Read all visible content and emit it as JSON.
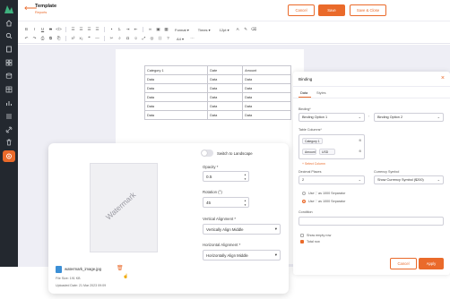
{
  "colors": {
    "accent": "#ea6a2a",
    "sidebar": "#23282f",
    "canvas": "#eeeef5"
  },
  "sidebar": {
    "icons": [
      "home-icon",
      "search-icon",
      "document-icon",
      "grid-icon",
      "database-icon",
      "table-icon",
      "chart-icon",
      "list-icon",
      "link-icon",
      "trash-icon",
      "settings-icon"
    ]
  },
  "header": {
    "title": "Template",
    "subtitle": "Reports",
    "cancel_label": "Cancel",
    "save_label": "Save",
    "save_close_label": "Save & Close"
  },
  "toolbar": {
    "format_label": "Format",
    "font_label": "Times",
    "size_label": "12pt",
    "zoom_label": "A4"
  },
  "doc_table": {
    "headers": [
      "Category 1",
      "Date",
      "Amount"
    ],
    "rows": [
      [
        "Data",
        "Data",
        "Data"
      ],
      [
        "Data",
        "Data",
        "Data"
      ],
      [
        "Data",
        "Data",
        "Data"
      ],
      [
        "Data",
        "Data",
        "Data"
      ],
      [
        "Data",
        "Data",
        "Data"
      ]
    ]
  },
  "binding": {
    "title": "Binding",
    "tabs": [
      "Data",
      "Styles"
    ],
    "binding_label": "Binding*",
    "option1": "Binding Option 1",
    "option2": "Binding Option 2",
    "table_columns_label": "Table Columns*",
    "chip1": "Category 1",
    "chip2_name": "Amount",
    "chip2_value": "USD",
    "select_column": "+ Select Column",
    "decimal_label": "Decimal Places",
    "decimal_value": "2",
    "currency_label": "Currency Symbol",
    "currency_value": "Show Currency Symbol ($200)",
    "sep1": "Use ',' as 1000 Separator",
    "sep2": "Use '.' as 1000 Separator",
    "condition_label": "Condition",
    "show_empty_label": "Show empty row",
    "total_row_label": "Total row",
    "cancel_label": "Cancel",
    "apply_label": "Apply"
  },
  "watermark": {
    "preview_text": "Watermark",
    "filename": "watermark_image.jpg",
    "file_size": "File Size: 191 KB",
    "uploaded": "Uploaded Date: 21 Mar 2023 09:09",
    "switch_label": "Switch to Landscape",
    "opacity_label": "Opacity *",
    "opacity_value": "0.5",
    "rotation_label": "Rotation (°)",
    "rotation_value": "45",
    "valign_label": "Vertical Alignment *",
    "valign_value": "Vertically Align Middle",
    "halign_label": "Horizontal Alignment *",
    "halign_value": "Horizontally Align Middle"
  }
}
